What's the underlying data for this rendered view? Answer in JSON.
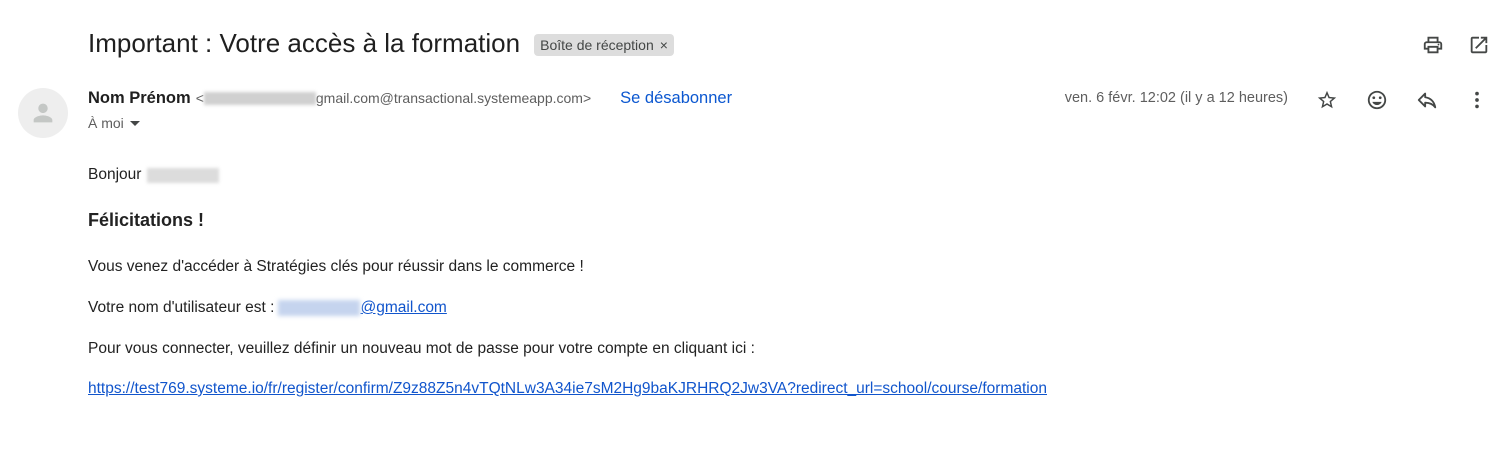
{
  "subject": "Important : Votre accès à la formation",
  "label_chip": {
    "text": "Boîte de réception",
    "remove": "×"
  },
  "sender": {
    "name": "Nom Prénom",
    "email_open": "<",
    "email_visible": "gmail.com@transactional.systemeapp.com>",
    "unsubscribe": "Se désabonner",
    "to": "À moi"
  },
  "date": "ven. 6 févr. 12:02 (il y a 12 heures)",
  "body": {
    "greeting": "Bonjour",
    "congrats": "Félicitations !",
    "line1": "Vous venez d'accéder à Stratégies clés pour réussir dans le commerce !",
    "line2_prefix": "Votre nom d'utilisateur est :",
    "line2_link_suffix": "@gmail.com",
    "line3": "Pour vous connecter, veuillez définir un nouveau mot de passe pour votre compte en cliquant ici :",
    "link": "https://test769.systeme.io/fr/register/confirm/Z9z88Z5n4vTQtNLw3A34ie7sM2Hg9baKJRHRQ2Jw3VA?redirect_url=school/course/formation"
  },
  "icons": {
    "print": "print-icon",
    "open_new_window": "open-in-new-icon",
    "star": "star-icon",
    "emoji": "emoji-icon",
    "reply": "reply-icon",
    "more": "more-vert-icon",
    "avatar": "person-icon"
  },
  "colors": {
    "link": "#1155cc",
    "unsubscribe": "#0b57d0",
    "chip": "#dddddd"
  }
}
